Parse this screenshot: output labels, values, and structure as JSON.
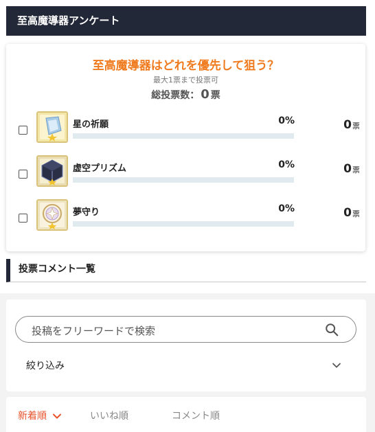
{
  "header": {
    "title": "至高魔導器アンケート"
  },
  "poll": {
    "question": "至高魔導器はどれを優先して狙う？",
    "note": "最大1票まで投票可",
    "total_label": "総投票数：",
    "total_count": "0",
    "total_unit": "票",
    "vote_unit": "票",
    "options": [
      {
        "name": "星の祈願",
        "percent": "0%",
        "votes": "0",
        "fill_fraction": 0,
        "icon": "star-prayer-icon"
      },
      {
        "name": "虚空プリズム",
        "percent": "0%",
        "votes": "0",
        "fill_fraction": 0,
        "icon": "void-prism-icon"
      },
      {
        "name": "夢守り",
        "percent": "0%",
        "votes": "0",
        "fill_fraction": 0,
        "icon": "dream-guard-icon"
      }
    ]
  },
  "comments": {
    "section_title": "投票コメント一覧",
    "search_placeholder": "投稿をフリーワードで検索",
    "filter_label": "絞り込み",
    "sort_tabs": [
      {
        "label": "新着順",
        "active": true
      },
      {
        "label": "いいね順",
        "active": false
      },
      {
        "label": "コメント順",
        "active": false
      }
    ]
  },
  "colors": {
    "header_bg": "#232838",
    "accent_orange": "#f07a1e",
    "sort_active": "#e8532b",
    "bar_track": "#e1ebef"
  }
}
